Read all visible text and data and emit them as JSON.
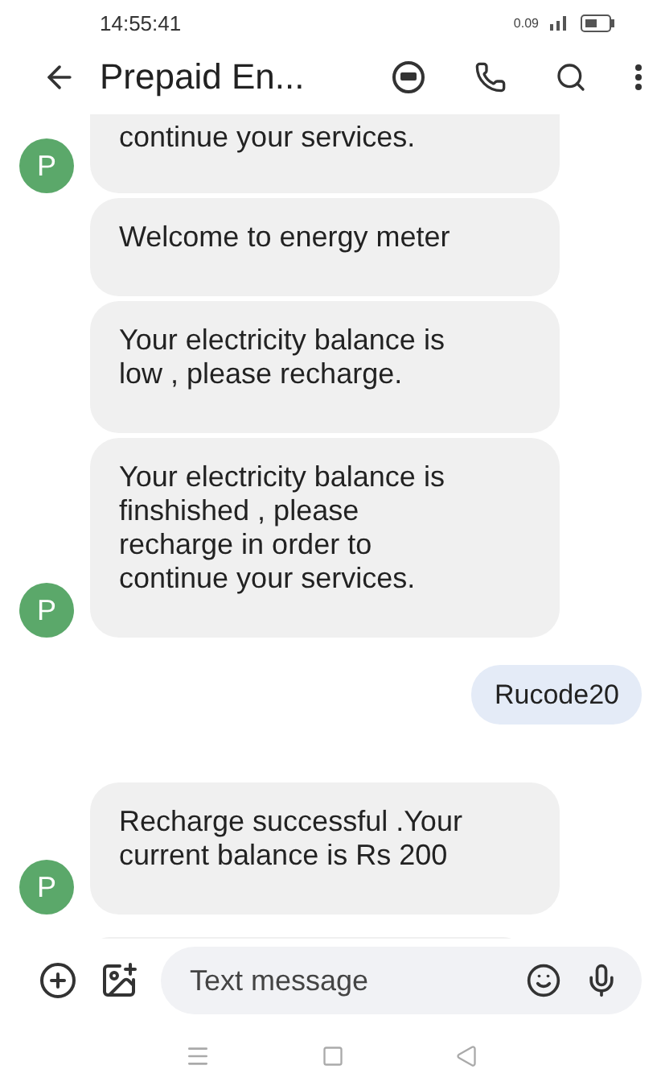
{
  "status_bar": {
    "time": "14:55:41",
    "speed": "0.09"
  },
  "header": {
    "title": "Prepaid En..."
  },
  "messages": [
    {
      "kind": "incoming",
      "text": "continue your services.",
      "avatar": "P",
      "cut_top": true
    },
    {
      "kind": "incoming",
      "text": "Welcome to energy meter"
    },
    {
      "kind": "incoming",
      "text": "Your electricity balance is low , please recharge."
    },
    {
      "kind": "incoming",
      "text": "Your electricity balance is finshished , please recharge in order to continue your services.",
      "avatar": "P"
    },
    {
      "kind": "outgoing",
      "text": "Rucode20"
    },
    {
      "kind": "incoming",
      "text": "Recharge successful .Your current balance is Rs 200",
      "avatar": "P",
      "gap_before": true
    },
    {
      "kind": "partial"
    }
  ],
  "composer": {
    "placeholder": "Text message"
  }
}
